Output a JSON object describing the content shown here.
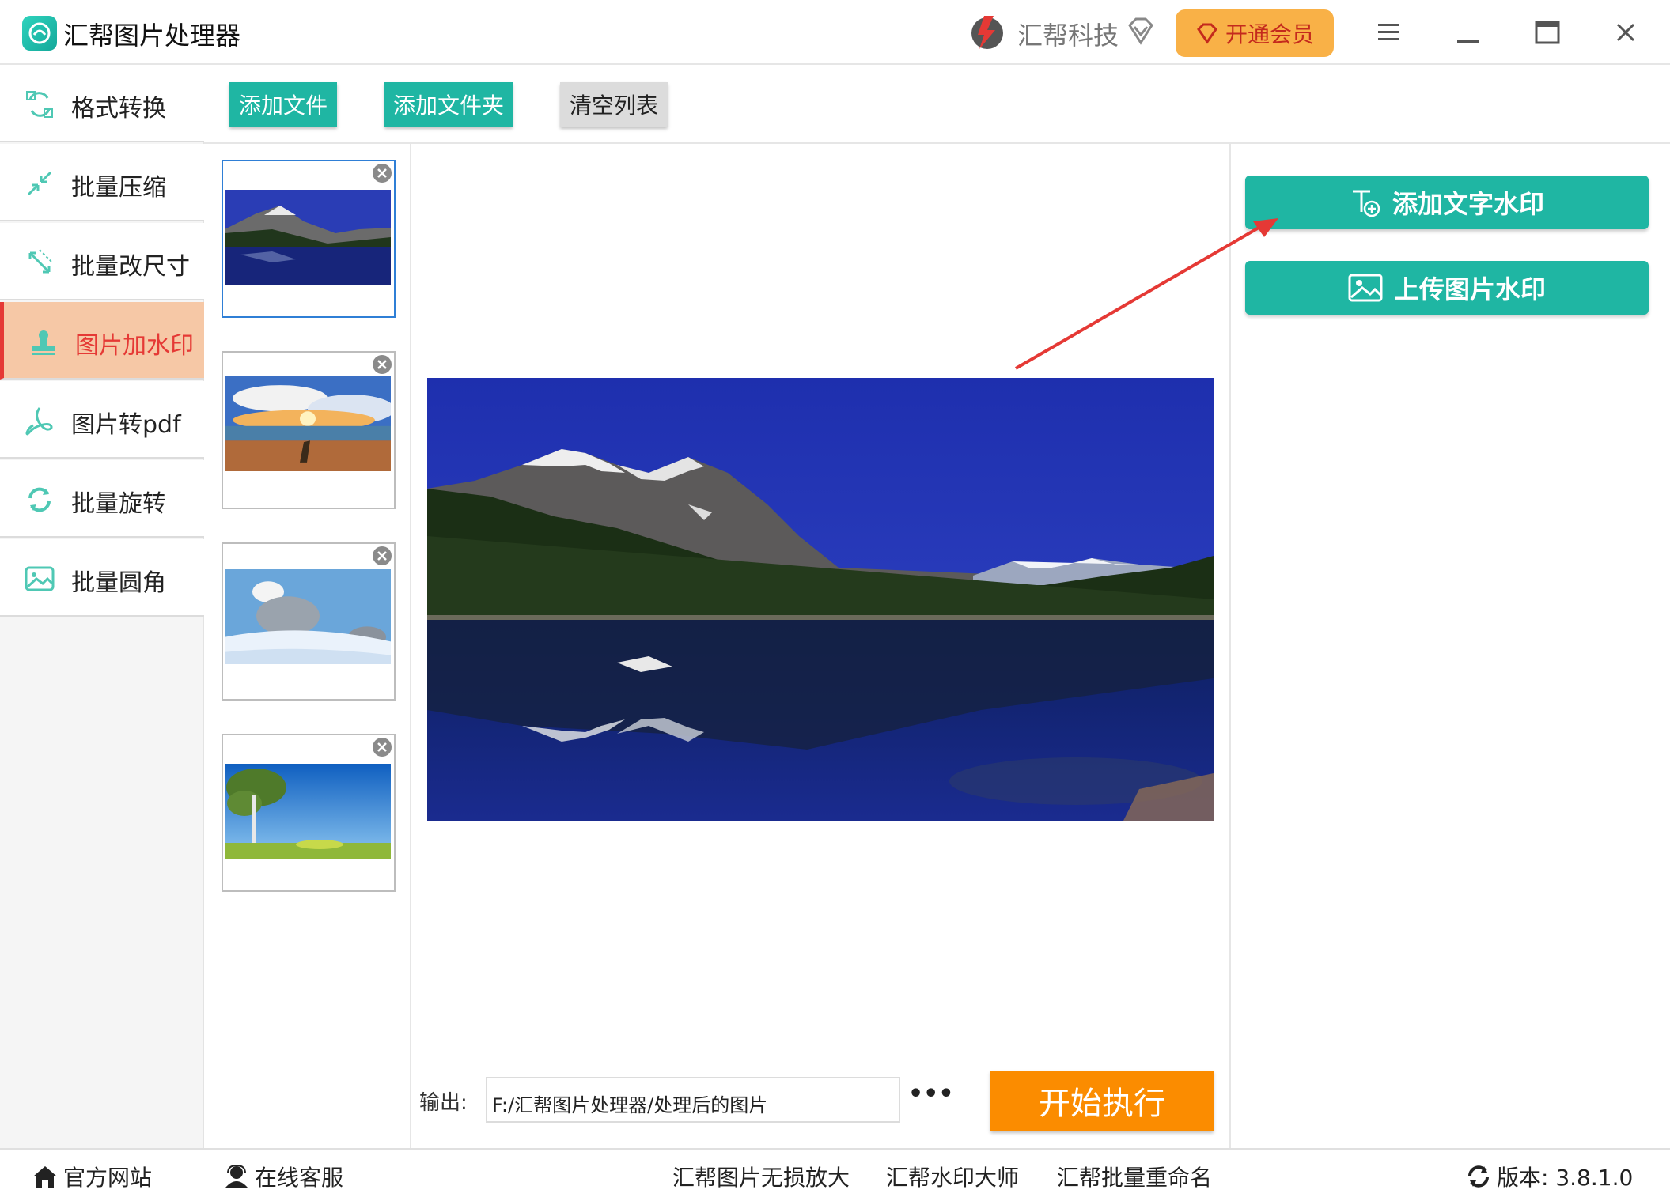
{
  "titlebar": {
    "app_title": "汇帮图片处理器",
    "brand_name": "汇帮科技",
    "vip_label": "开通会员"
  },
  "sidebar": {
    "items": [
      {
        "label": "格式转换",
        "icon": "format-convert-icon"
      },
      {
        "label": "批量压缩",
        "icon": "compress-icon"
      },
      {
        "label": "批量改尺寸",
        "icon": "resize-icon"
      },
      {
        "label": "图片加水印",
        "icon": "watermark-stamp-icon",
        "active": true
      },
      {
        "label": "图片转pdf",
        "icon": "pdf-icon"
      },
      {
        "label": "批量旋转",
        "icon": "rotate-icon"
      },
      {
        "label": "批量圆角",
        "icon": "round-corner-icon"
      }
    ]
  },
  "toolbar": {
    "add_file": "添加文件",
    "add_folder": "添加文件夹",
    "clear_list": "清空列表"
  },
  "thumbnails": [
    {
      "scene": "mountain-lake",
      "selected": true
    },
    {
      "scene": "sunset-beach",
      "selected": false
    },
    {
      "scene": "snowy-trees",
      "selected": false
    },
    {
      "scene": "tree-blue-sky",
      "selected": false
    }
  ],
  "preview": {
    "scene": "mountain-lake"
  },
  "output": {
    "label": "输出:",
    "path": "F:/汇帮图片处理器/处理后的图片",
    "browse": "•••",
    "start": "开始执行"
  },
  "watermark": {
    "add_text": "添加文字水印",
    "upload_image": "上传图片水印"
  },
  "statusbar": {
    "website": "官方网站",
    "support": "在线客服",
    "links": [
      "汇帮图片无损放大",
      "汇帮水印大师",
      "汇帮批量重命名"
    ],
    "version": "版本: 3.8.1.0"
  },
  "colors": {
    "accent": "#1fb6a3",
    "active_nav": "#f6c8a6",
    "active_text": "#e53935",
    "start_button": "#fb8c00",
    "vip_button": "#f9b147"
  }
}
